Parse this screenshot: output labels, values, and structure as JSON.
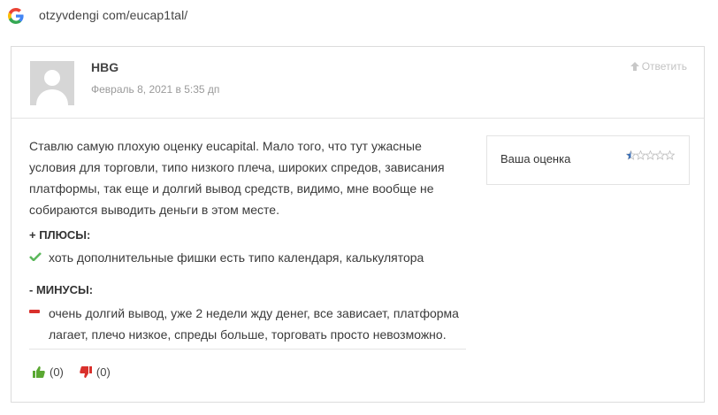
{
  "address_bar": {
    "url": "otzyvdengi com/eucap1tal/",
    "logo_icon": "google-g-icon"
  },
  "review": {
    "author": "HBG",
    "date": "Февраль 8, 2021 в 5:35 дп",
    "reply_label": "Ответить",
    "text": "Ставлю самую плохую оценку eucapital. Мало того, что тут ужасные условия для торговли, типо низкого плеча, широких спредов, зависания платформы, так еще и долгий вывод средств, видимо, мне вообще не собираются выводить деньги в этом месте.",
    "pros_title": "+ ПЛЮСЫ:",
    "pros_item": "хоть дополнительные фишки есть типо календаря, калькулятора",
    "cons_title": "- МИНУСЫ:",
    "cons_item": "очень долгий вывод, уже 2 недели жду денег, все зависает, платформа лагает, плечо низкое, спреды больше, торговать просто невозможно.",
    "likes": "(0)",
    "dislikes": "(0)"
  },
  "rating": {
    "label": "Ваша оценка",
    "value": 0.5,
    "max": 5,
    "filled_color": "#3b6fb6",
    "empty_color": "#bdbdbd"
  },
  "colors": {
    "check": "#5cb85c",
    "minus": "#d9302c",
    "like": "#5aa832",
    "dislike": "#d9302c"
  }
}
